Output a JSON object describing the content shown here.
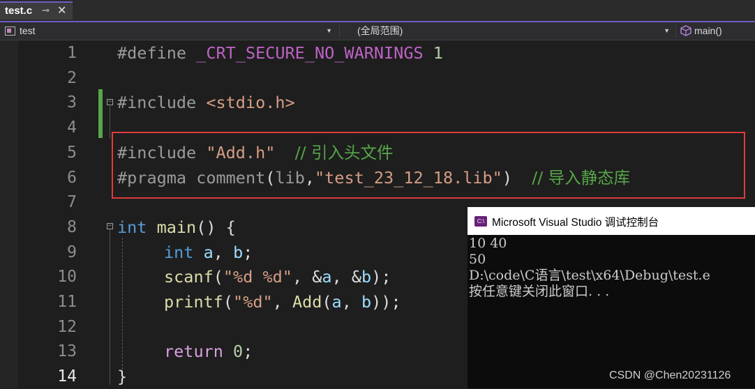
{
  "tab": {
    "label": "test.c",
    "pin_glyph": "⊸",
    "close_glyph": "✕"
  },
  "navbar": {
    "project": "test",
    "scope": "(全局范围)",
    "member": "main()"
  },
  "editor": {
    "current_line": 14,
    "line_numbers": [
      "1",
      "2",
      "3",
      "4",
      "5",
      "6",
      "7",
      "8",
      "9",
      "10",
      "11",
      "12",
      "13",
      "14"
    ],
    "lines": {
      "l1": {
        "kw": "#define",
        "name": "_CRT_SECURE_NO_WARNINGS",
        "value": "1"
      },
      "l3": {
        "kw": "#include",
        "header": "<stdio.h>"
      },
      "l5": {
        "kw": "#include",
        "header": "\"Add.h\"",
        "comment": "// 引入头文件"
      },
      "l6": {
        "kw": "#pragma",
        "directive": "comment",
        "open": "(",
        "lib": "lib",
        "comma": ",",
        "str": "\"test_23_12_18.lib\"",
        "close": ")",
        "comment": "// 导入静态库"
      },
      "l8": {
        "type": "int",
        "name": "main",
        "rest": "() {"
      },
      "l9": {
        "type": "int",
        "a": "a",
        "sep": ", ",
        "b": "b",
        "end": ";"
      },
      "l10": {
        "fn": "scanf",
        "open": "(",
        "fmt": "\"%d %d\"",
        "mid": ", &",
        "a": "a",
        "mid2": ", &",
        "b": "b",
        "end": ");"
      },
      "l11": {
        "fn": "printf",
        "open": "(",
        "fmt": "\"%d\"",
        "mid": ", ",
        "fn2": "Add",
        "open2": "(",
        "a": "a",
        "sep": ", ",
        "b": "b",
        "end": "));"
      },
      "l13": {
        "kw": "return",
        "sp": " ",
        "value": "0",
        "end": ";"
      },
      "l14": {
        "brace": "}"
      }
    }
  },
  "console": {
    "title": "Microsoft Visual Studio 调试控制台",
    "icon_text": "C:\\",
    "output_lines": [
      "10 40",
      "50",
      "D:\\code\\C语言\\test\\x64\\Debug\\test.e",
      "按任意键关闭此窗口. . ."
    ]
  },
  "watermark": "CSDN @Chen20231126",
  "colors": {
    "accent": "#6f5bc6",
    "highlight_box": "#e03b3b",
    "change_bar": "#57a64a"
  }
}
